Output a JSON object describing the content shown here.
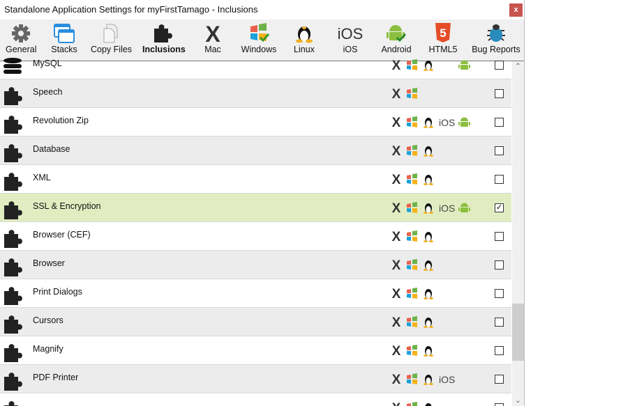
{
  "window": {
    "title": "Standalone Application Settings for myFirstTamago - Inclusions",
    "close_label": "x"
  },
  "toolbar": [
    {
      "label": "General",
      "icon": "gear-icon"
    },
    {
      "label": "Stacks",
      "icon": "stacks-icon"
    },
    {
      "label": "Copy Files",
      "icon": "copy-files-icon"
    },
    {
      "label": "Inclusions",
      "icon": "puzzle-icon",
      "selected": true
    },
    {
      "label": "Mac",
      "icon": "mac-icon"
    },
    {
      "label": "Windows",
      "icon": "windows-icon"
    },
    {
      "label": "Linux",
      "icon": "linux-icon"
    },
    {
      "label": "iOS",
      "icon": "ios-icon"
    },
    {
      "label": "Android",
      "icon": "android-icon"
    },
    {
      "label": "HTML5",
      "icon": "html5-icon"
    },
    {
      "label": "Bug Reports",
      "icon": "bug-icon"
    }
  ],
  "ios_text": "iOS",
  "html5_glyph": "5",
  "inclusions": [
    {
      "name": "MySQL",
      "icon": "database-icon",
      "platforms": [
        "mac",
        "windows",
        "linux",
        "android"
      ],
      "checked": false
    },
    {
      "name": "Speech",
      "platforms": [
        "mac",
        "windows"
      ],
      "checked": false
    },
    {
      "name": "Revolution Zip",
      "platforms": [
        "mac",
        "windows",
        "linux",
        "ios",
        "android"
      ],
      "checked": false
    },
    {
      "name": "Database",
      "platforms": [
        "mac",
        "windows",
        "linux"
      ],
      "checked": false
    },
    {
      "name": "XML",
      "platforms": [
        "mac",
        "windows",
        "linux"
      ],
      "checked": false
    },
    {
      "name": "SSL & Encryption",
      "platforms": [
        "mac",
        "windows",
        "linux",
        "ios",
        "android"
      ],
      "checked": true
    },
    {
      "name": "Browser (CEF)",
      "platforms": [
        "mac",
        "windows",
        "linux"
      ],
      "checked": false
    },
    {
      "name": "Browser",
      "platforms": [
        "mac",
        "windows",
        "linux"
      ],
      "checked": false
    },
    {
      "name": "Print Dialogs",
      "platforms": [
        "mac",
        "windows",
        "linux"
      ],
      "checked": false
    },
    {
      "name": "Cursors",
      "platforms": [
        "mac",
        "windows",
        "linux"
      ],
      "checked": false
    },
    {
      "name": "Magnify",
      "platforms": [
        "mac",
        "windows",
        "linux"
      ],
      "checked": false
    },
    {
      "name": "PDF Printer",
      "platforms": [
        "mac",
        "windows",
        "linux",
        "ios"
      ],
      "checked": false
    },
    {
      "name": "",
      "platforms": [
        "mac",
        "windows",
        "linux"
      ],
      "checked": false
    }
  ],
  "colors": {
    "highlight": "#e1edc1",
    "close": "#c85450",
    "android": "#8cbf3f",
    "html5": "#e44d26"
  }
}
